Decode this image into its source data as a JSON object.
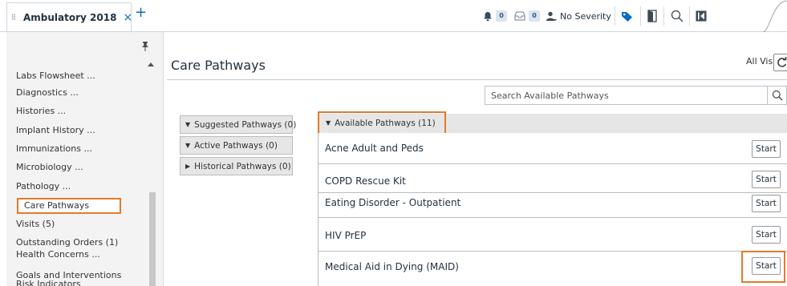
{
  "tabbar": {
    "tab_title": "Ambulatory 2018",
    "close_glyph": "×",
    "add_glyph": "+",
    "grip_glyph": "⁞⁞",
    "notifications_count": "0",
    "inbox_count": "0",
    "severity_label": "No Severity",
    "icons": [
      "bell-icon",
      "inbox-icon",
      "person-icon",
      "tag-icon",
      "door-icon",
      "search-icon",
      "collapse-icon"
    ]
  },
  "sidebar": {
    "items": [
      "Labs Flowsheet ...",
      "Diagnostics ...",
      "Histories ...",
      "Implant History ...",
      "Immunizations ...",
      "Microbiology ...",
      "Pathology ...",
      "Care Pathways",
      "Visits (5)",
      "Outstanding Orders (1)",
      "Health Concerns ...",
      "Goals and Interventions",
      "Risk Indicators"
    ],
    "selected": "Care Pathways"
  },
  "main": {
    "title": "Care Pathways",
    "all_visits_label": "All Visits",
    "search_placeholder": "Search Available Pathways",
    "accordions": [
      "Suggested Pathways (0)",
      "Active Pathways (0)",
      "Historical Pathways (0)"
    ],
    "available_header": "Available Pathways (11)",
    "pathways": [
      "Acne Adult and Peds",
      "COPD Rescue Kit",
      "Eating Disorder - Outpatient",
      "HIV PrEP",
      "Medical Aid in Dying (MAID)"
    ],
    "start_label": "Start"
  },
  "colors": {
    "highlight": "#e5792a",
    "accent": "#0a6bc2"
  }
}
